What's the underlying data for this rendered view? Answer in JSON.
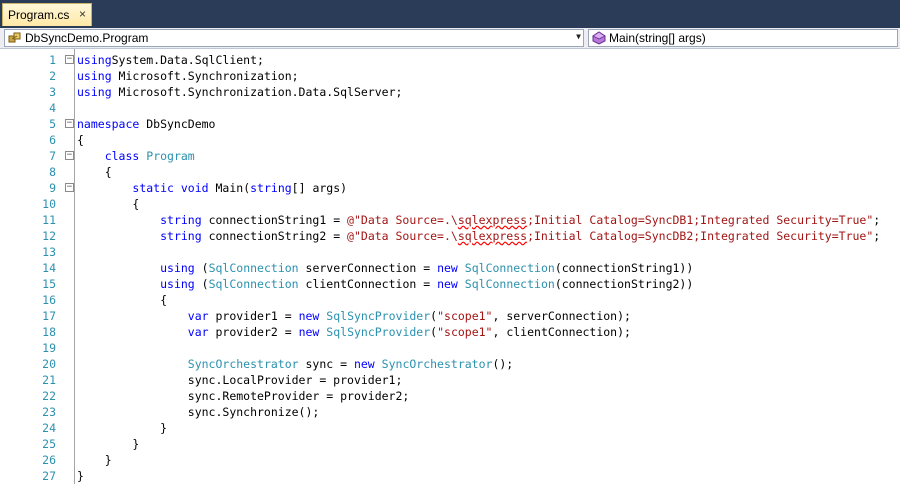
{
  "tab": {
    "title": "Program.cs",
    "close": "×"
  },
  "navigation": {
    "type_dropdown": "DbSyncDemo.Program",
    "member_dropdown": "Main(string[] args)"
  },
  "colors": {
    "keyword": "#0000ff",
    "type": "#2b91af",
    "string": "#a31515",
    "line_number": "#2b91af"
  },
  "lines": [
    {
      "num": "1",
      "fold": "minus",
      "tokens": [
        [
          "kw",
          "using"
        ],
        [
          "",
          "System.Data.SqlClient;"
        ]
      ]
    },
    {
      "num": "2",
      "tokens": [
        [
          "kw",
          "using"
        ],
        [
          "",
          " Microsoft.Synchronization;"
        ]
      ]
    },
    {
      "num": "3",
      "tokens": [
        [
          "kw",
          "using"
        ],
        [
          "",
          " Microsoft.Synchronization.Data.SqlServer;"
        ]
      ]
    },
    {
      "num": "4",
      "tokens": []
    },
    {
      "num": "5",
      "fold": "minus",
      "tokens": [
        [
          "kw",
          "namespace"
        ],
        [
          "",
          " DbSyncDemo"
        ]
      ]
    },
    {
      "num": "6",
      "tokens": [
        [
          "",
          "{"
        ]
      ]
    },
    {
      "num": "7",
      "fold": "minus",
      "tokens": [
        [
          "",
          "    "
        ],
        [
          "kw",
          "class"
        ],
        [
          "",
          " "
        ],
        [
          "ty",
          "Program"
        ]
      ]
    },
    {
      "num": "8",
      "tokens": [
        [
          "",
          "    {"
        ]
      ]
    },
    {
      "num": "9",
      "fold": "minus",
      "tokens": [
        [
          "",
          "        "
        ],
        [
          "kw",
          "static"
        ],
        [
          "",
          " "
        ],
        [
          "kw",
          "void"
        ],
        [
          "",
          " Main("
        ],
        [
          "kw",
          "string"
        ],
        [
          "",
          "[] args)"
        ]
      ]
    },
    {
      "num": "10",
      "tokens": [
        [
          "",
          "        {"
        ]
      ]
    },
    {
      "num": "11",
      "tokens": [
        [
          "",
          "            "
        ],
        [
          "kw",
          "string"
        ],
        [
          "",
          " connectionString1 = "
        ],
        [
          "st",
          "@\"Data Source=.\\"
        ],
        [
          "sq",
          "sqlexpress"
        ],
        [
          "st",
          ";Initial Catalog=SyncDB1;Integrated Security=True\""
        ],
        [
          "",
          ";"
        ]
      ]
    },
    {
      "num": "12",
      "tokens": [
        [
          "",
          "            "
        ],
        [
          "kw",
          "string"
        ],
        [
          "",
          " connectionString2 = "
        ],
        [
          "st",
          "@\"Data Source=.\\"
        ],
        [
          "sq",
          "sqlexpress"
        ],
        [
          "st",
          ";Initial Catalog=SyncDB2;Integrated Security=True\""
        ],
        [
          "",
          ";"
        ]
      ]
    },
    {
      "num": "13",
      "tokens": []
    },
    {
      "num": "14",
      "tokens": [
        [
          "",
          "            "
        ],
        [
          "kw",
          "using"
        ],
        [
          "",
          " ("
        ],
        [
          "ty",
          "SqlConnection"
        ],
        [
          "",
          " serverConnection = "
        ],
        [
          "kw",
          "new"
        ],
        [
          "",
          " "
        ],
        [
          "ty",
          "SqlConnection"
        ],
        [
          "",
          "(connectionString1))"
        ]
      ]
    },
    {
      "num": "15",
      "tokens": [
        [
          "",
          "            "
        ],
        [
          "kw",
          "using"
        ],
        [
          "",
          " ("
        ],
        [
          "ty",
          "SqlConnection"
        ],
        [
          "",
          " clientConnection = "
        ],
        [
          "kw",
          "new"
        ],
        [
          "",
          " "
        ],
        [
          "ty",
          "SqlConnection"
        ],
        [
          "",
          "(connectionString2))"
        ]
      ]
    },
    {
      "num": "16",
      "tokens": [
        [
          "",
          "            {"
        ]
      ]
    },
    {
      "num": "17",
      "tokens": [
        [
          "",
          "                "
        ],
        [
          "kw",
          "var"
        ],
        [
          "",
          " provider1 = "
        ],
        [
          "kw",
          "new"
        ],
        [
          "",
          " "
        ],
        [
          "ty",
          "SqlSyncProvider"
        ],
        [
          "",
          "("
        ],
        [
          "st",
          "\"scope1\""
        ],
        [
          "",
          ", serverConnection);"
        ]
      ]
    },
    {
      "num": "18",
      "tokens": [
        [
          "",
          "                "
        ],
        [
          "kw",
          "var"
        ],
        [
          "",
          " provider2 = "
        ],
        [
          "kw",
          "new"
        ],
        [
          "",
          " "
        ],
        [
          "ty",
          "SqlSyncProvider"
        ],
        [
          "",
          "("
        ],
        [
          "st",
          "\"scope1\""
        ],
        [
          "",
          ", clientConnection);"
        ]
      ]
    },
    {
      "num": "19",
      "tokens": []
    },
    {
      "num": "20",
      "tokens": [
        [
          "",
          "                "
        ],
        [
          "ty",
          "SyncOrchestrator"
        ],
        [
          "",
          " sync = "
        ],
        [
          "kw",
          "new"
        ],
        [
          "",
          " "
        ],
        [
          "ty",
          "SyncOrchestrator"
        ],
        [
          "",
          "();"
        ]
      ]
    },
    {
      "num": "21",
      "tokens": [
        [
          "",
          "                sync.LocalProvider = provider1;"
        ]
      ]
    },
    {
      "num": "22",
      "tokens": [
        [
          "",
          "                sync.RemoteProvider = provider2;"
        ]
      ]
    },
    {
      "num": "23",
      "tokens": [
        [
          "",
          "                sync.Synchronize();"
        ]
      ]
    },
    {
      "num": "24",
      "tokens": [
        [
          "",
          "            }"
        ]
      ]
    },
    {
      "num": "25",
      "tokens": [
        [
          "",
          "        }"
        ]
      ]
    },
    {
      "num": "26",
      "tokens": [
        [
          "",
          "    }"
        ]
      ]
    },
    {
      "num": "27",
      "tokens": [
        [
          "",
          "}"
        ]
      ]
    }
  ]
}
